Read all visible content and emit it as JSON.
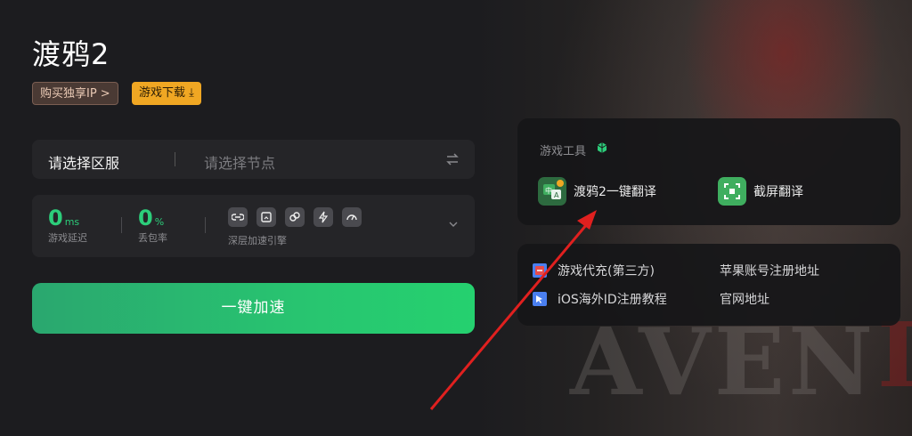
{
  "game": {
    "title": "渡鸦2",
    "buy_ip_label": "购买独享IP >",
    "download_label": "游戏下载 ⤓"
  },
  "server": {
    "region_label": "请选择区服",
    "node_placeholder": "请选择节点"
  },
  "stats": {
    "latency": {
      "value": "0",
      "unit": "ms",
      "label": "游戏延迟"
    },
    "packet_loss": {
      "value": "0",
      "unit": "%",
      "label": "丢包率"
    },
    "engine_label": "深层加速引擎"
  },
  "boost_button_label": "一键加速",
  "tools": {
    "title": "游戏工具",
    "items": [
      {
        "label": "渡鸦2一键翻译",
        "icon": "translate-icon"
      },
      {
        "label": "截屏翻译",
        "icon": "screenshot-translate-icon"
      }
    ]
  },
  "links": [
    {
      "label": "游戏代充(第三方)",
      "icon": "recharge-icon"
    },
    {
      "label": "苹果账号注册地址",
      "icon": ""
    },
    {
      "label": "iOS海外ID注册教程",
      "icon": "tutorial-icon"
    },
    {
      "label": "官网地址",
      "icon": ""
    }
  ],
  "background_text": "AVEN",
  "colors": {
    "accent_green": "#2ccd7a",
    "download_orange": "#f0a723",
    "annotation_red": "#e0201f"
  }
}
